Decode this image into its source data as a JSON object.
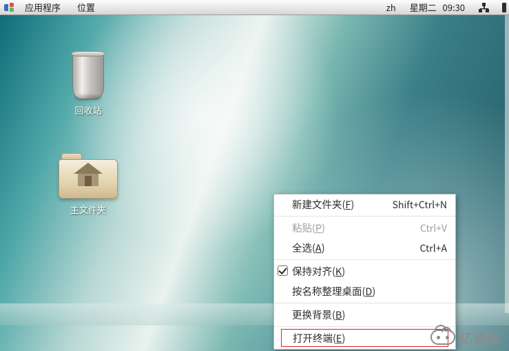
{
  "panel": {
    "menu_apps": "应用程序",
    "menu_places": "位置",
    "ime": "zh",
    "date": "星期二",
    "time_h": "09",
    "time_m": "30"
  },
  "desktop": {
    "trash_label": "回收站",
    "home_label": "主文件夹"
  },
  "ctx": {
    "new_folder_pre": "新建文件夹(",
    "new_folder_mn": "F",
    "new_folder_post": ")",
    "new_folder_sc": "Shift+Ctrl+N",
    "paste_pre": "粘贴(",
    "paste_mn": "P",
    "paste_post": ")",
    "paste_sc": "Ctrl+V",
    "selectall_pre": "全选(",
    "selectall_mn": "A",
    "selectall_post": ")",
    "selectall_sc": "Ctrl+A",
    "keepalign_pre": "保持对齐(",
    "keepalign_mn": "K",
    "keepalign_post": ")",
    "orgname_pre": "按名称整理桌面(",
    "orgname_mn": "D",
    "orgname_post": ")",
    "changebg_pre": "更换背景(",
    "changebg_mn": "B",
    "changebg_post": ")",
    "openterm_pre": "打开终端(",
    "openterm_mn": "E",
    "openterm_post": ")"
  },
  "watermark": {
    "text": "亿速云"
  }
}
